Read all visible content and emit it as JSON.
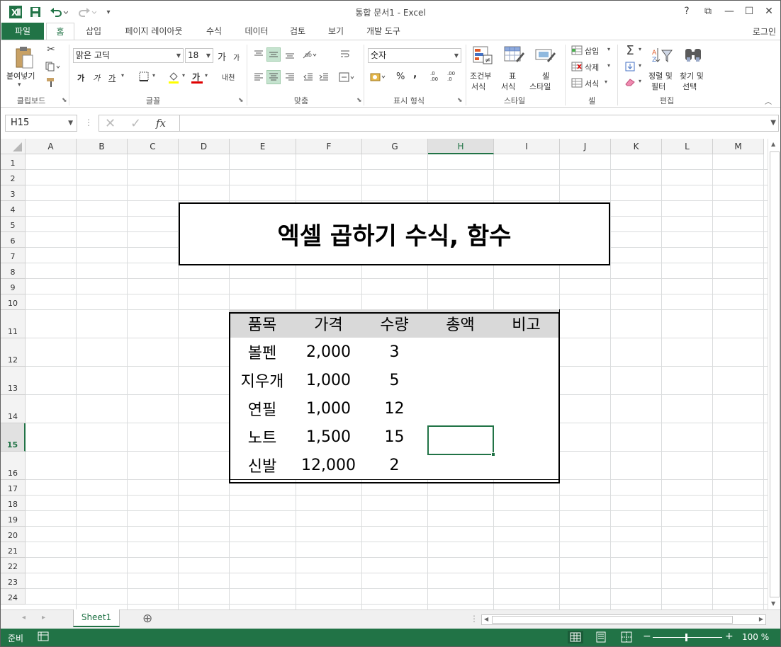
{
  "window": {
    "title": "통합 문서1 - Excel",
    "help": "?",
    "restore_ribbon": "⧉",
    "minimize": "—",
    "maximize": "☐",
    "close": "✕"
  },
  "quick_access": {
    "app_icon": "excel-logo-icon",
    "save": "save-icon",
    "undo": "undo-icon",
    "redo": "redo-icon"
  },
  "tabs": [
    "파일",
    "홈",
    "삽입",
    "페이지 레이아웃",
    "수식",
    "데이터",
    "검토",
    "보기",
    "개발 도구"
  ],
  "active_tab": "홈",
  "account": "로그인",
  "ribbon": {
    "clipboard": {
      "label": "클립보드",
      "paste": "붙여넣기"
    },
    "font": {
      "label": "글꼴",
      "name": "맑은 고딕",
      "size": "18",
      "bold": "가",
      "italic": "가",
      "underline": "가",
      "grow": "가",
      "shrink": "가",
      "font_color": "가",
      "phonetic": "내천"
    },
    "alignment": {
      "label": "맞춤"
    },
    "number": {
      "label": "표시 형식",
      "format": "숫자",
      "percent": "%",
      "comma": ",",
      "inc_decimal": ".0 .00",
      "dec_decimal": ".00 .0"
    },
    "styles": {
      "label": "스타일",
      "conditional_line1": "조건부",
      "conditional_line2": "서식",
      "table_line1": "표",
      "table_line2": "서식",
      "cell_line1": "셀",
      "cell_line2": "스타일"
    },
    "cells": {
      "label": "셀",
      "insert": "삽입",
      "delete": "삭제",
      "format": "서식"
    },
    "editing": {
      "label": "편집",
      "sort_line1": "정렬 및",
      "sort_line2": "필터",
      "find_line1": "찾기 및",
      "find_line2": "선택"
    }
  },
  "formula_bar": {
    "name_box": "H15",
    "fx": "fx",
    "formula": ""
  },
  "columns": [
    "A",
    "B",
    "C",
    "D",
    "E",
    "F",
    "G",
    "H",
    "I",
    "J",
    "K",
    "L",
    "M"
  ],
  "rows": [
    "1",
    "2",
    "3",
    "4",
    "5",
    "6",
    "7",
    "8",
    "9",
    "10",
    "11",
    "12",
    "13",
    "14",
    "15",
    "16",
    "17",
    "18",
    "19",
    "20",
    "21",
    "22",
    "23",
    "24"
  ],
  "selected": {
    "column": "H",
    "row": "15"
  },
  "sheet_title": "엑셀 곱하기 수식, 함수",
  "table": {
    "headers": [
      "품목",
      "가격",
      "수량",
      "총액",
      "비고"
    ],
    "rows": [
      [
        "볼펜",
        "2,000",
        "3",
        "",
        ""
      ],
      [
        "지우개",
        "1,000",
        "5",
        "",
        ""
      ],
      [
        "연필",
        "1,000",
        "12",
        "",
        ""
      ],
      [
        "노트",
        "1,500",
        "15",
        "",
        ""
      ],
      [
        "신발",
        "12,000",
        "2",
        "",
        ""
      ]
    ]
  },
  "sheets": {
    "active": "Sheet1",
    "add": "⊕"
  },
  "status": {
    "ready": "준비",
    "zoom": "100 %",
    "minus": "−",
    "plus": "+"
  },
  "colors": {
    "accent": "#217346",
    "header_fill": "#d9d9d9"
  }
}
